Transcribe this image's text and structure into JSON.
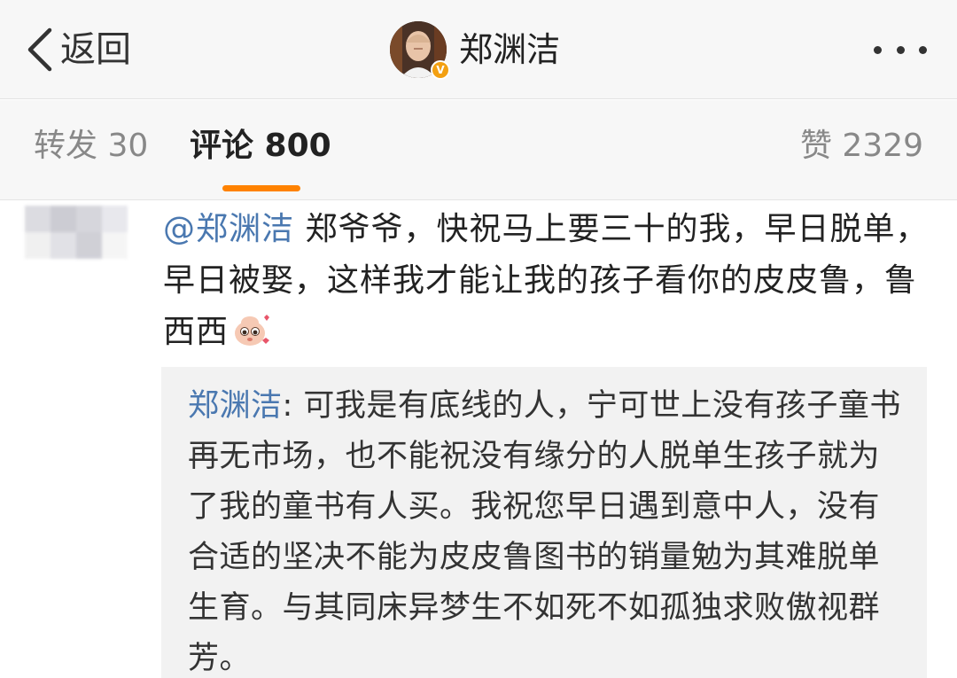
{
  "navbar": {
    "back_label": "返回",
    "profile_name": "郑渊洁",
    "verified_badge": "V",
    "more_icon": "more-horizontal-icon"
  },
  "tabs": {
    "reposts": "转发 30",
    "comments": "评论 800",
    "likes": "赞 2329",
    "active": "comments",
    "accent_color": "#ff8200"
  },
  "comment": {
    "mention": "@郑渊洁",
    "text": " 郑爷爷，快祝马上要三十的我，早日脱单，早日被娶，这样我才能让我的孩子看你的皮皮鲁，鲁西西",
    "emoji": "cute-sticker-emoji",
    "avatar_blurred": true
  },
  "reply": {
    "author": "郑渊洁",
    "text": ": 可我是有底线的人，宁可世上没有孩子童书再无市场，也不能祝没有缘分的人脱单生孩子就为了我的童书有人买。我祝您早日遇到意中人，没有合适的坚决不能为皮皮鲁图书的销量勉为其难脱单生育。与其同床异梦生不如死不如孤独求败傲视群芳。"
  },
  "colors": {
    "link": "#4a78b0",
    "header_bg": "#f7f7f7",
    "reply_bg": "#f2f2f2"
  }
}
